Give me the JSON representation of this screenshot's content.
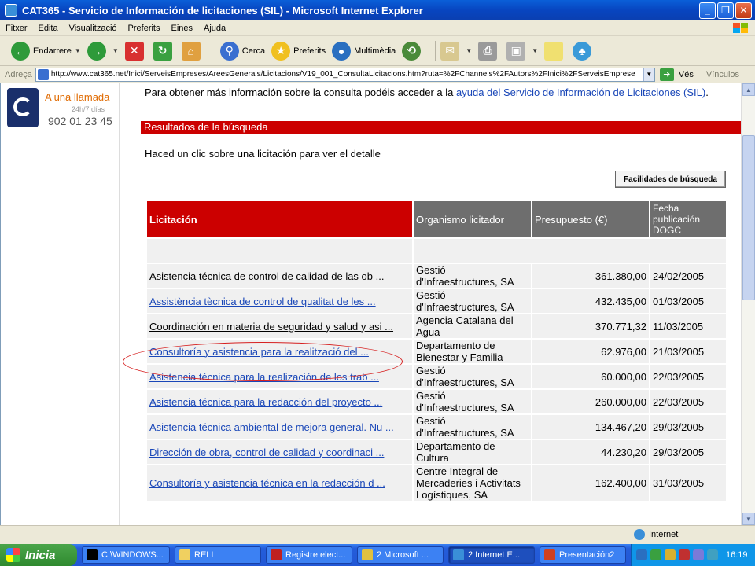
{
  "window": {
    "title": "CAT365 - Servicio de Información de licitaciones (SIL) - Microsoft Internet Explorer"
  },
  "menu": [
    "Fitxer",
    "Edita",
    "Visualització",
    "Preferits",
    "Eines",
    "Ajuda"
  ],
  "toolbar": {
    "back": "Endarrere",
    "search": "Cerca",
    "favorites": "Preferits",
    "media": "Multimèdia"
  },
  "address": {
    "label": "Adreça",
    "url": "http://www.cat365.net/Inici/ServeisEmpreses/AreesGenerals/Licitacions/V19_001_ConsultaLicitacions.htm?ruta=%2FChannels%2FAutors%2FInici%2FServeisEmprese",
    "go": "Vés",
    "links": "Vínculos"
  },
  "ad": {
    "line1": "A una llamada",
    "line2": "24h/7 días",
    "phone": "902 01 23 45"
  },
  "info": {
    "text": "Para obtener más información sobre la consulta podéis acceder a la ",
    "link": "ayuda del Servicio de Información de Licitaciones (SIL)",
    "end": "."
  },
  "results": {
    "header": "Resultados de la búsqueda",
    "instruction": "Haced un clic sobre una licitación para ver el detalle",
    "search_button": "Facilidades de búsqueda",
    "columns": {
      "lic": "Licitación",
      "org": "Organismo licitador",
      "pre": "Presupuesto (€)",
      "fec": "Fecha publicación DOGC"
    },
    "rows": [
      {
        "lic": "Asistencia técnica de control de calidad de las ob ...",
        "org": "Gestió d'Infraestructures, SA",
        "pre": "361.380,00",
        "fec": "24/02/2005",
        "visited": true
      },
      {
        "lic": "Assistència tècnica de control de qualitat de les ...",
        "org": "Gestió d'Infraestructures, SA",
        "pre": "432.435,00",
        "fec": "01/03/2005",
        "visited": false
      },
      {
        "lic": "Coordinación en materia de seguridad y salud y asi ...",
        "org": "Agencia Catalana del Agua",
        "pre": "370.771,32",
        "fec": "11/03/2005",
        "visited": true
      },
      {
        "lic": "Consultoría y asistencia para la realització del ...",
        "org": "Departamento de Bienestar y Familia",
        "pre": "62.976,00",
        "fec": "21/03/2005",
        "visited": false
      },
      {
        "lic": "Asistencia técnica para la realización de los trab ...",
        "org": "Gestió d'Infraestructures, SA",
        "pre": "60.000,00",
        "fec": "22/03/2005",
        "visited": false
      },
      {
        "lic": "Asistencia técnica para la redacción del proyecto ...",
        "org": "Gestió d'Infraestructures, SA",
        "pre": "260.000,00",
        "fec": "22/03/2005",
        "visited": false
      },
      {
        "lic": "Asistencia técnica ambiental de mejora general. Nu ...",
        "org": "Gestió d'Infraestructures, SA",
        "pre": "134.467,20",
        "fec": "29/03/2005",
        "visited": false
      },
      {
        "lic": "Dirección de obra, control de calidad y coordinaci ...",
        "org": "Departamento de Cultura",
        "pre": "44.230,20",
        "fec": "29/03/2005",
        "visited": false
      },
      {
        "lic": "Consultoría y asistencia técnica en la redacción d ...",
        "org": "Centre Integral de Mercaderies i Activitats Logístiques, SA",
        "pre": "162.400,00",
        "fec": "31/03/2005",
        "visited": false
      }
    ]
  },
  "status": {
    "zone": "Internet"
  },
  "taskbar": {
    "start": "Inicia",
    "tasks": [
      "C:\\WINDOWS...",
      "RELI",
      "Registre elect...",
      "2 Microsoft ...",
      "2 Internet E...",
      "Presentación2"
    ],
    "lang": "ES",
    "clock": "16:19"
  }
}
